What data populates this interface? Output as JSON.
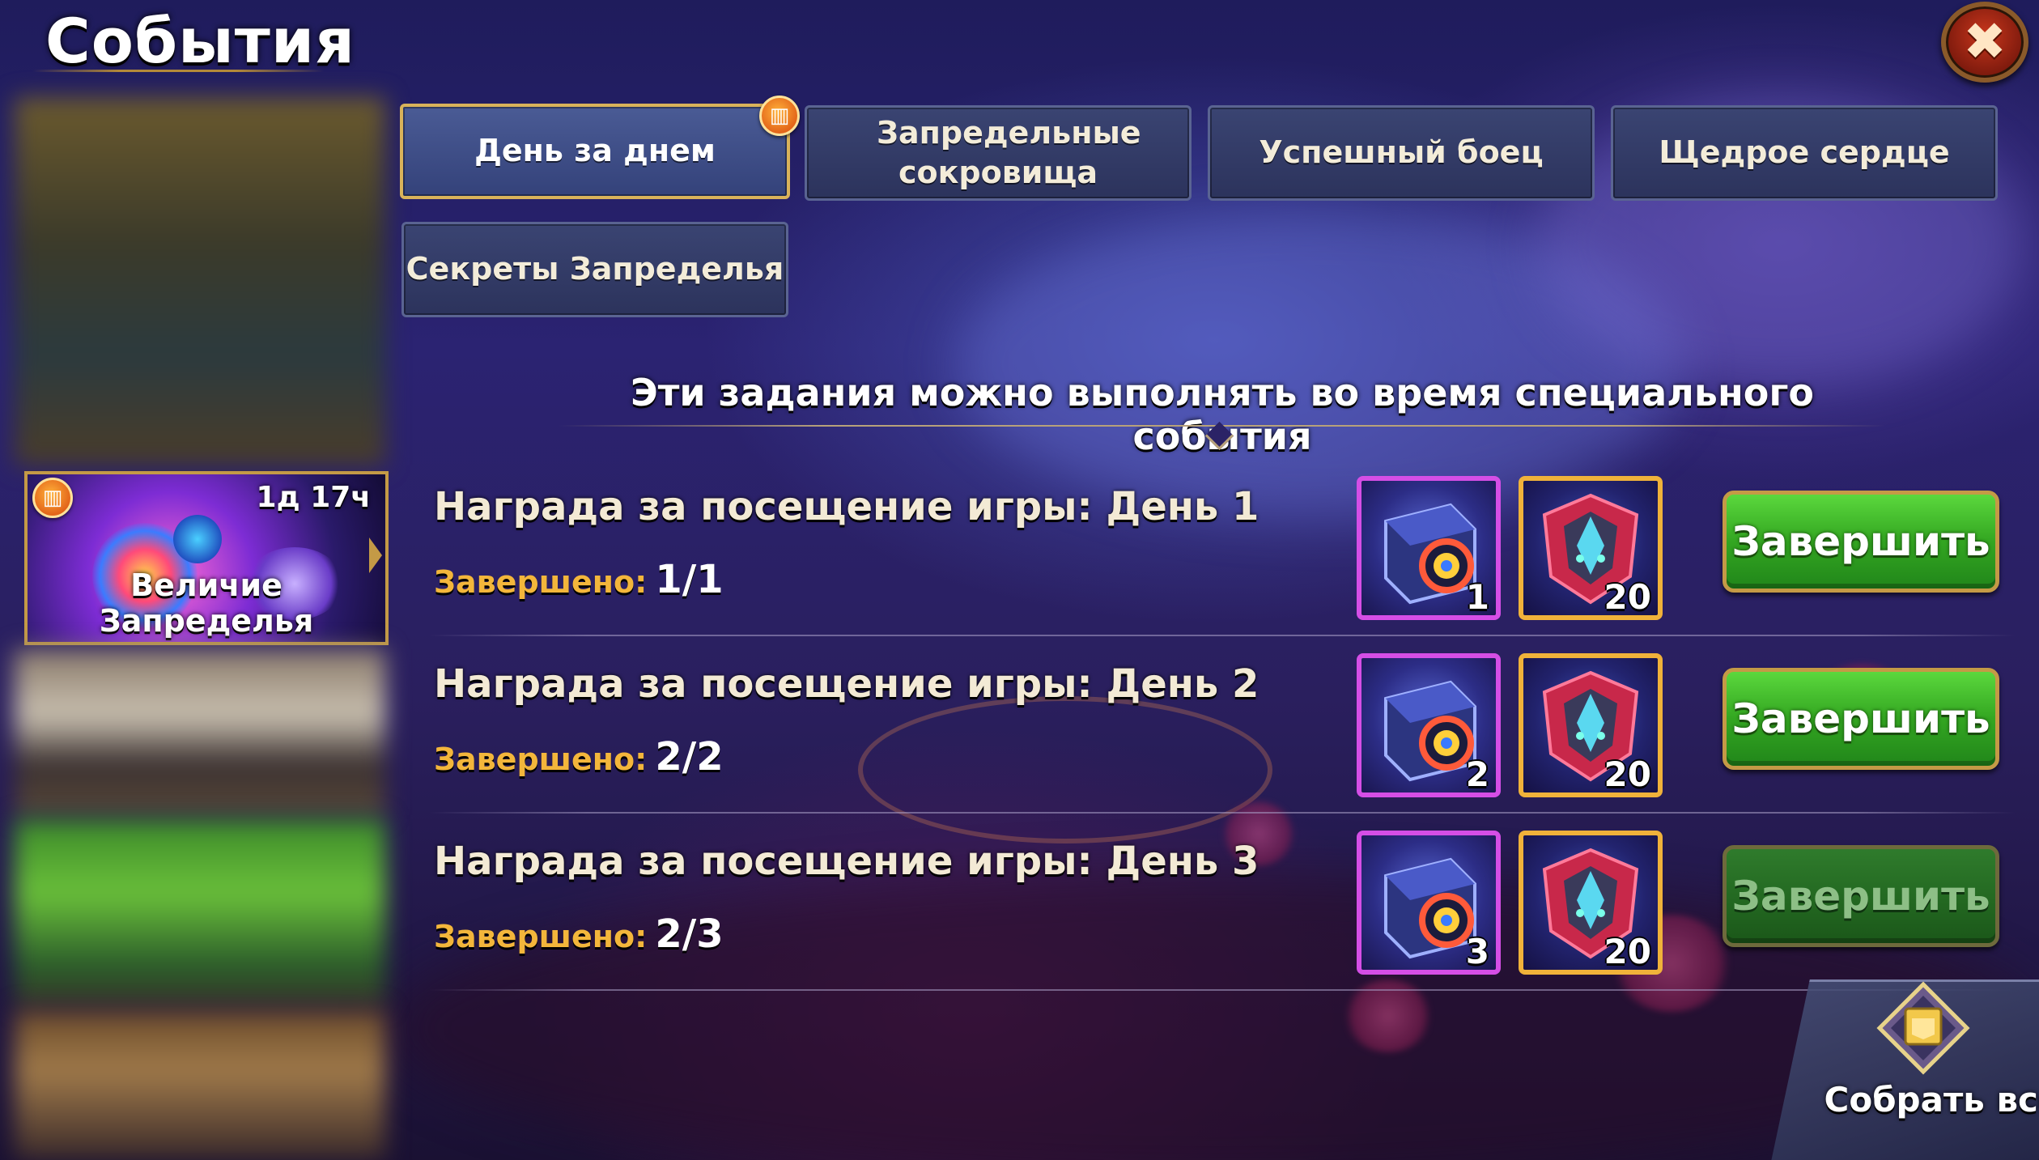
{
  "header": {
    "title": "События"
  },
  "close": {
    "label": "✖"
  },
  "sidebar": {
    "selected": {
      "name": "Величие Запределья",
      "timer": "1д 17ч",
      "gift_icon": "gift-icon"
    }
  },
  "tabs": [
    {
      "label": "День за днем",
      "active": true,
      "has_gift_badge": true
    },
    {
      "label": "Запредельные сокровища"
    },
    {
      "label": "Успешный боец"
    },
    {
      "label": "Щедрое сердце"
    },
    {
      "label": "Секреты Запределья"
    }
  ],
  "info": {
    "text": "Эти задания можно выполнять во время специального события"
  },
  "tasks": [
    {
      "title": "Награда за посещение игры: День 1",
      "progress_label": "Завершено:",
      "progress_value": "1/1",
      "rewards": [
        {
          "icon": "chest-icon",
          "count": "1",
          "frame": "purple"
        },
        {
          "icon": "emblem-icon",
          "count": "20",
          "frame": "gold"
        }
      ],
      "button": "Завершить",
      "enabled": true
    },
    {
      "title": "Награда за посещение игры: День 2",
      "progress_label": "Завершено:",
      "progress_value": "2/2",
      "rewards": [
        {
          "icon": "chest-icon",
          "count": "2",
          "frame": "purple"
        },
        {
          "icon": "emblem-icon",
          "count": "20",
          "frame": "gold"
        }
      ],
      "button": "Завершить",
      "enabled": true
    },
    {
      "title": "Награда за посещение игры: День 3",
      "progress_label": "Завершено:",
      "progress_value": "2/3",
      "rewards": [
        {
          "icon": "chest-icon",
          "count": "3",
          "frame": "purple"
        },
        {
          "icon": "emblem-icon",
          "count": "20",
          "frame": "gold"
        }
      ],
      "button": "Завершить",
      "enabled": false
    }
  ],
  "collect_all": {
    "label": "Собрать всё",
    "icon": "collect-all-icon"
  },
  "colors": {
    "accent_gold": "#c49a46",
    "button_green": "#33a621",
    "progress_label": "#f3b63b"
  }
}
